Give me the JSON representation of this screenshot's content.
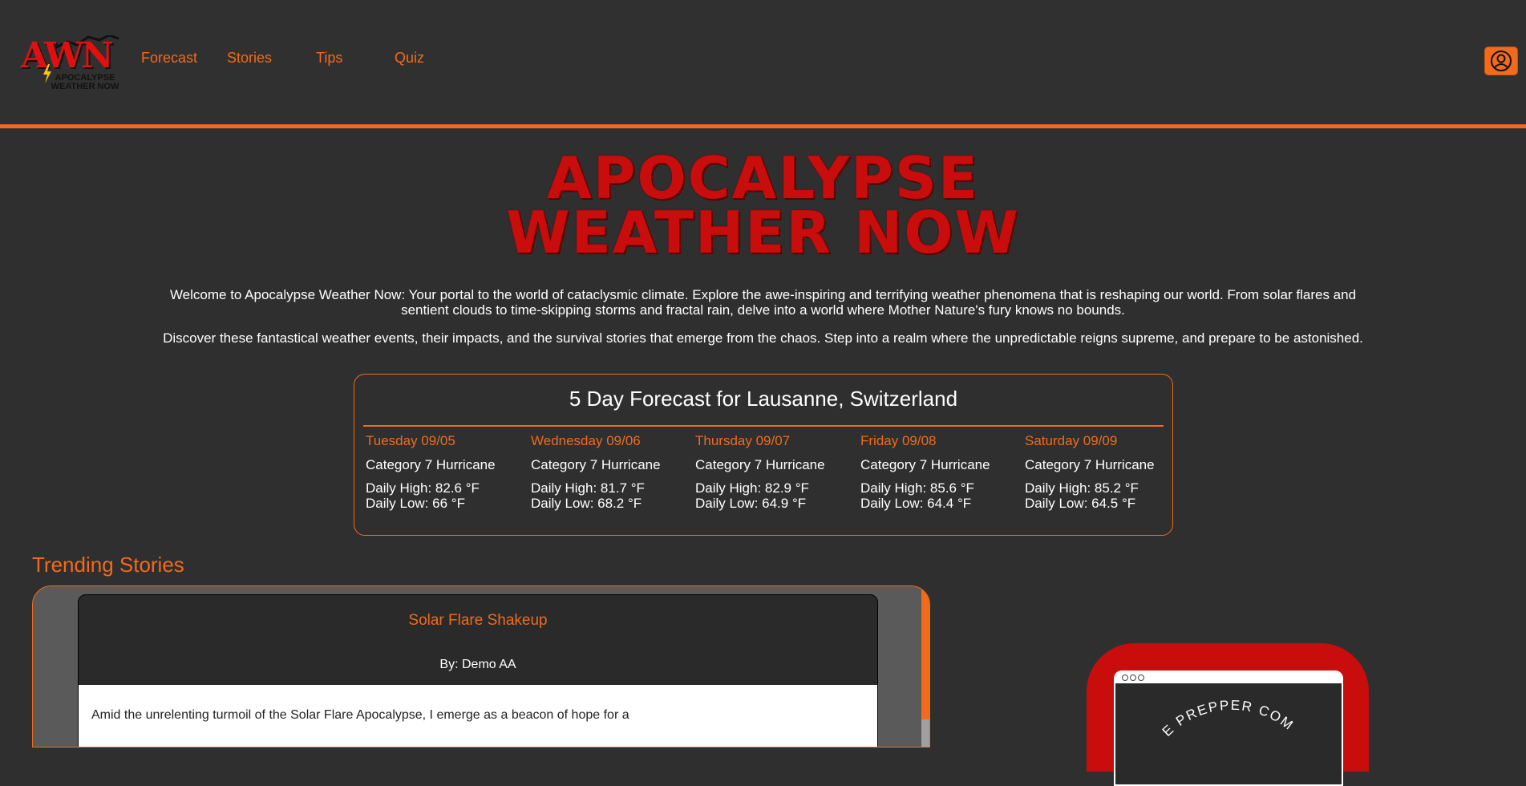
{
  "brand": {
    "logo_mark": "AWN",
    "logo_subtitle": "APOCALYPSE WEATHER NOW"
  },
  "nav": {
    "items": [
      "Forecast",
      "Stories",
      "Tips",
      "Quiz"
    ]
  },
  "account_button": {
    "icon": "user-icon"
  },
  "hero": {
    "title_line1": "APOCALYPSE",
    "title_line2": "WEATHER NOW",
    "intro1": "Welcome to Apocalypse Weather Now: Your portal to the world of cataclysmic climate. Explore the awe-inspiring and terrifying weather phenomena that is reshaping our world. From solar flares and sentient clouds to time-skipping storms and fractal rain, delve into a world where Mother Nature's fury knows no bounds.",
    "intro2": "Discover these fantastical weather events, their impacts, and the survival stories that emerge from the chaos. Step into a realm where the unpredictable reigns supreme, and prepare to be astonished."
  },
  "forecast": {
    "title": "5 Day Forecast for Lausanne, Switzerland",
    "days": [
      {
        "date": "Tuesday 09/05",
        "condition": "Category 7 Hurricane",
        "high": "Daily High: 82.6 °F",
        "low": "Daily Low: 66 °F"
      },
      {
        "date": "Wednesday 09/06",
        "condition": "Category 7 Hurricane",
        "high": "Daily High: 81.7 °F",
        "low": "Daily Low: 68.2 °F"
      },
      {
        "date": "Thursday 09/07",
        "condition": "Category 7 Hurricane",
        "high": "Daily High: 82.9 °F",
        "low": "Daily Low: 64.9 °F"
      },
      {
        "date": "Friday 09/08",
        "condition": "Category 7 Hurricane",
        "high": "Daily High: 85.6 °F",
        "low": "Daily Low: 64.4 °F"
      },
      {
        "date": "Saturday 09/09",
        "condition": "Category 7 Hurricane",
        "high": "Daily High: 85.2 °F",
        "low": "Daily Low: 64.5 °F"
      }
    ]
  },
  "trending": {
    "heading": "Trending Stories",
    "story": {
      "title": "Solar Flare Shakeup",
      "author": "By: Demo AA",
      "excerpt": "Amid the unrelenting turmoil of the Solar Flare Apocalypse, I emerge as a beacon of hope for a"
    }
  },
  "promo": {
    "arc_text": "E PREPPER COM"
  },
  "colors": {
    "accent": "#f26a1b",
    "title_red": "#c90d0d",
    "background": "#2f2f2f"
  }
}
